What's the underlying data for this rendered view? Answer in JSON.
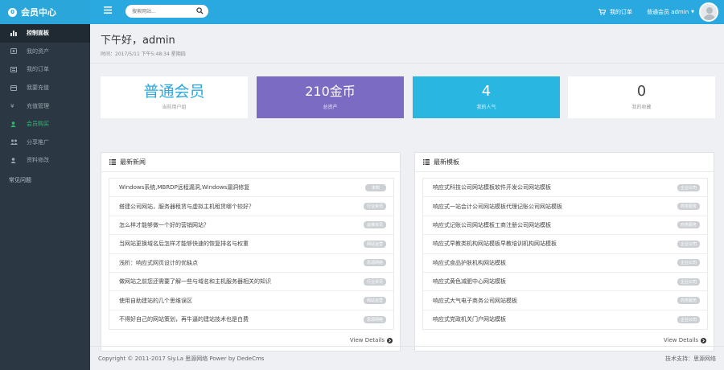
{
  "brand": {
    "title": "会员中心",
    "logo_glyph": "0"
  },
  "header": {
    "search": {
      "placeholder": "搜索网站...",
      "value": ""
    },
    "cart_label": "我的订单",
    "user_label": "普通会员 admin",
    "accent": "#29a9df"
  },
  "sidebar": {
    "items": [
      {
        "label": "控制面板",
        "icon": "chart-bar-icon"
      },
      {
        "label": "我的资产",
        "icon": "coins-icon"
      },
      {
        "label": "我的订单",
        "icon": "list-icon"
      },
      {
        "label": "我要充值",
        "icon": "credit-card-icon"
      },
      {
        "label": "充值管理",
        "icon": "yen-icon"
      },
      {
        "label": "会员购买",
        "icon": "user-icon"
      },
      {
        "label": "分享推广",
        "icon": "users-icon"
      },
      {
        "label": "资料修改",
        "icon": "user-edit-icon"
      }
    ],
    "faq_label": "常见问题"
  },
  "greeting": {
    "title": "下午好，admin",
    "time": "时间：2017/5/11 下午5:48:34 星期四"
  },
  "stats": [
    {
      "value": "普通会员",
      "label": "当前用户组"
    },
    {
      "value": "210金币",
      "label": "总资产"
    },
    {
      "value": "4",
      "label": "我的人气"
    },
    {
      "value": "0",
      "label": "我的收藏"
    }
  ],
  "news": {
    "title": "最新新闻",
    "more": "View Details",
    "items": [
      {
        "title": "Windows系统,MBRDP远程漏洞,Windows漏洞修复",
        "tag": "未知"
      },
      {
        "title": "搭建公司网站，服务器租赁与虚拟主机租赁哪个较好？",
        "tag": "行业资讯"
      },
      {
        "title": "怎么样才能够做一个好的营销网站？",
        "tag": "运维资讯"
      },
      {
        "title": "当网站更换域名后怎样才能够快速的恢复排名与权重",
        "tag": "网站运营"
      },
      {
        "title": "浅析：响应式网页设计的优缺点",
        "tag": "思源网络"
      },
      {
        "title": "做网站之前您还需要了解一些与域名和主机服务器相关的知识",
        "tag": "行业资讯"
      },
      {
        "title": "使用自助建站的几个思维误区",
        "tag": "网站运营"
      },
      {
        "title": "不得好自己的网站策划，再牛逼的建站技术也是白费",
        "tag": "思源网络"
      }
    ]
  },
  "templates": {
    "title": "最新模板",
    "more": "View Details",
    "items": [
      {
        "title": "响应式科技公司网站模板软件开发公司网站模板",
        "tag": "企业公司"
      },
      {
        "title": "响应式一站会计公司网站模板代理记账公司网站模板",
        "tag": "商务服务"
      },
      {
        "title": "响应式记账公司网站模板工商注册公司网站模板",
        "tag": "商务服务"
      },
      {
        "title": "响应式早教类机构网站模板早教培训机构网站模板",
        "tag": "企业公司"
      },
      {
        "title": "响应式食品护肤机构网站模板",
        "tag": "企业公司"
      },
      {
        "title": "响应式黄色减肥中心网站模板",
        "tag": "企业公司"
      },
      {
        "title": "响应式大气电子商务公司网站模板",
        "tag": "商务服务"
      },
      {
        "title": "响应式党政机关门户网站模板",
        "tag": "企业公司"
      }
    ]
  },
  "footer": {
    "copyright": "Copyright © 2011-2017 Siy.La 思源网络 Power by DedeCms",
    "support": "技术支持：思源网络"
  }
}
